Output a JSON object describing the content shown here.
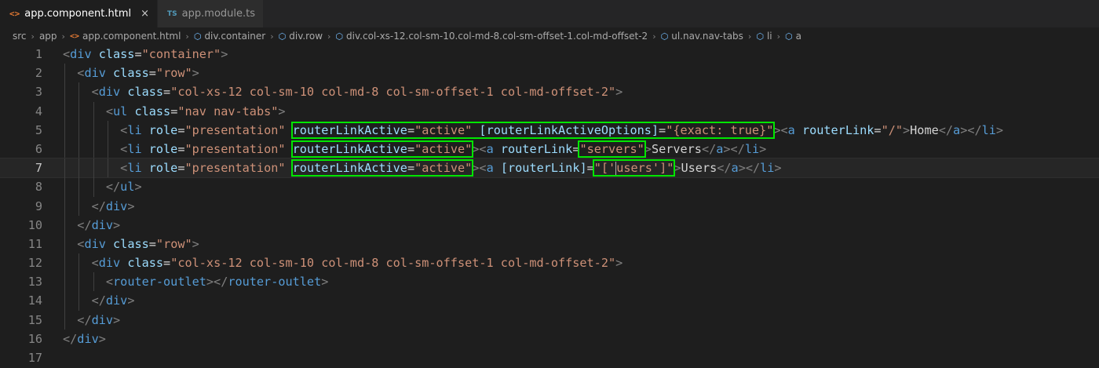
{
  "tabs": [
    {
      "label": "app.component.html",
      "icon": "<>",
      "active": true,
      "close": "×"
    },
    {
      "label": "app.module.ts",
      "icon": "TS",
      "active": false
    }
  ],
  "breadcrumb": [
    "src",
    "app",
    "app.component.html",
    "div.container",
    "div.row",
    "div.col-xs-12.col-sm-10.col-md-8.col-sm-offset-1.col-md-offset-2",
    "ul.nav.nav-tabs",
    "li",
    "a"
  ],
  "editor": {
    "current_line": 7,
    "lines": [
      {
        "n": "1",
        "tokens": [
          [
            "t",
            "<"
          ],
          [
            "n",
            "div"
          ],
          [
            "a",
            " class"
          ],
          [
            "e",
            "="
          ],
          [
            "s",
            "\"container\""
          ],
          [
            "t",
            ">"
          ]
        ]
      },
      {
        "n": "2",
        "tokens": [
          [
            "e",
            "  "
          ],
          [
            "t",
            "<"
          ],
          [
            "n",
            "div"
          ],
          [
            "a",
            " class"
          ],
          [
            "e",
            "="
          ],
          [
            "s",
            "\"row\""
          ],
          [
            "t",
            ">"
          ]
        ]
      },
      {
        "n": "3",
        "tokens": [
          [
            "e",
            "    "
          ],
          [
            "t",
            "<"
          ],
          [
            "n",
            "div"
          ],
          [
            "a",
            " class"
          ],
          [
            "e",
            "="
          ],
          [
            "s",
            "\"col-xs-12 col-sm-10 col-md-8 col-sm-offset-1 col-md-offset-2\""
          ],
          [
            "t",
            ">"
          ]
        ]
      },
      {
        "n": "4",
        "tokens": [
          [
            "e",
            "      "
          ],
          [
            "t",
            "<"
          ],
          [
            "n",
            "ul"
          ],
          [
            "a",
            " class"
          ],
          [
            "e",
            "="
          ],
          [
            "s",
            "\"nav nav-tabs\""
          ],
          [
            "t",
            ">"
          ]
        ]
      },
      {
        "n": "5",
        "tokens": [
          [
            "e",
            "        "
          ],
          [
            "t",
            "<"
          ],
          [
            "n",
            "li"
          ],
          [
            "a",
            " role"
          ],
          [
            "e",
            "="
          ],
          [
            "s",
            "\"presentation\""
          ],
          [
            "e",
            " "
          ],
          [
            "box",
            "routerLinkActive=\"active\" [routerLinkActiveOptions]=\"{exact: true}\""
          ],
          [
            "t",
            ">"
          ],
          [
            "t",
            "<"
          ],
          [
            "n",
            "a"
          ],
          [
            "a",
            " routerLink"
          ],
          [
            "e",
            "="
          ],
          [
            "s",
            "\"/\""
          ],
          [
            "t",
            ">"
          ],
          [
            "e",
            "Home"
          ],
          [
            "t",
            "</"
          ],
          [
            "n",
            "a"
          ],
          [
            "t",
            "></"
          ],
          [
            "n",
            "li"
          ],
          [
            "t",
            ">"
          ]
        ]
      },
      {
        "n": "6",
        "tokens": [
          [
            "e",
            "        "
          ],
          [
            "t",
            "<"
          ],
          [
            "n",
            "li"
          ],
          [
            "a",
            " role"
          ],
          [
            "e",
            "="
          ],
          [
            "s",
            "\"presentation\""
          ],
          [
            "e",
            " "
          ],
          [
            "box",
            "routerLinkActive=\"active\""
          ],
          [
            "t",
            "><"
          ],
          [
            "n",
            "a"
          ],
          [
            "a",
            " routerLink"
          ],
          [
            "e",
            "="
          ],
          [
            "boxs",
            "\"servers\""
          ],
          [
            "t",
            ">"
          ],
          [
            "e",
            "Servers"
          ],
          [
            "t",
            "</"
          ],
          [
            "n",
            "a"
          ],
          [
            "t",
            "></"
          ],
          [
            "n",
            "li"
          ],
          [
            "t",
            ">"
          ]
        ]
      },
      {
        "n": "7",
        "tokens": [
          [
            "e",
            "        "
          ],
          [
            "t",
            "<"
          ],
          [
            "n",
            "li"
          ],
          [
            "a",
            " role"
          ],
          [
            "e",
            "="
          ],
          [
            "s",
            "\"presentation\""
          ],
          [
            "e",
            " "
          ],
          [
            "box",
            "routerLinkActive=\"active\""
          ],
          [
            "t",
            "><"
          ],
          [
            "n",
            "a"
          ],
          [
            "a",
            " [routerLink]"
          ],
          [
            "e",
            "="
          ],
          [
            "boxcaret",
            "\"['users']\""
          ],
          [
            "t",
            ">"
          ],
          [
            "e",
            "Users"
          ],
          [
            "t",
            "</"
          ],
          [
            "n",
            "a"
          ],
          [
            "t",
            "></"
          ],
          [
            "n",
            "li"
          ],
          [
            "t",
            ">"
          ]
        ]
      },
      {
        "n": "8",
        "tokens": [
          [
            "e",
            "      "
          ],
          [
            "t",
            "</"
          ],
          [
            "n",
            "ul"
          ],
          [
            "t",
            ">"
          ]
        ]
      },
      {
        "n": "9",
        "tokens": [
          [
            "e",
            "    "
          ],
          [
            "t",
            "</"
          ],
          [
            "n",
            "div"
          ],
          [
            "t",
            ">"
          ]
        ]
      },
      {
        "n": "10",
        "tokens": [
          [
            "e",
            "  "
          ],
          [
            "t",
            "</"
          ],
          [
            "n",
            "div"
          ],
          [
            "t",
            ">"
          ]
        ]
      },
      {
        "n": "11",
        "tokens": [
          [
            "e",
            "  "
          ],
          [
            "t",
            "<"
          ],
          [
            "n",
            "div"
          ],
          [
            "a",
            " class"
          ],
          [
            "e",
            "="
          ],
          [
            "s",
            "\"row\""
          ],
          [
            "t",
            ">"
          ]
        ]
      },
      {
        "n": "12",
        "tokens": [
          [
            "e",
            "    "
          ],
          [
            "t",
            "<"
          ],
          [
            "n",
            "div"
          ],
          [
            "a",
            " class"
          ],
          [
            "e",
            "="
          ],
          [
            "s",
            "\"col-xs-12 col-sm-10 col-md-8 col-sm-offset-1 col-md-offset-2\""
          ],
          [
            "t",
            ">"
          ]
        ]
      },
      {
        "n": "13",
        "tokens": [
          [
            "e",
            "      "
          ],
          [
            "t",
            "<"
          ],
          [
            "n",
            "router-outlet"
          ],
          [
            "t",
            "></"
          ],
          [
            "n",
            "router-outlet"
          ],
          [
            "t",
            ">"
          ]
        ]
      },
      {
        "n": "14",
        "tokens": [
          [
            "e",
            "    "
          ],
          [
            "t",
            "</"
          ],
          [
            "n",
            "div"
          ],
          [
            "t",
            ">"
          ]
        ]
      },
      {
        "n": "15",
        "tokens": [
          [
            "e",
            "  "
          ],
          [
            "t",
            "</"
          ],
          [
            "n",
            "div"
          ],
          [
            "t",
            ">"
          ]
        ]
      },
      {
        "n": "16",
        "tokens": [
          [
            "t",
            "</"
          ],
          [
            "n",
            "div"
          ],
          [
            "t",
            ">"
          ]
        ]
      },
      {
        "n": "17",
        "tokens": []
      }
    ]
  }
}
